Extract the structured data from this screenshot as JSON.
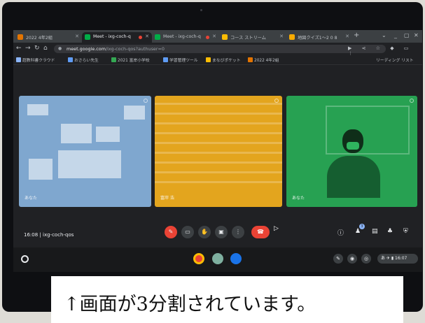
{
  "browser": {
    "tabs": [
      {
        "label": "2022 4年2組",
        "icon_color": "#e37400",
        "active": false
      },
      {
        "label": "Meet - ixg-coch-q",
        "icon_color": "#00ac47",
        "active": true
      },
      {
        "label": "Meet - ixg-coch-q",
        "icon_color": "#00ac47",
        "active": false
      },
      {
        "label": "コース ストリーム",
        "icon_color": "#fbbc04",
        "active": false
      },
      {
        "label": "地図クイズ1～2 0 8",
        "icon_color": "#f9ab00",
        "active": false
      }
    ],
    "new_tab_label": "+",
    "url_host": "meet.google.com",
    "url_path": "/ixg-coch-qos?authuser=0",
    "bookmarks": [
      {
        "label": "超教科書クラウド",
        "icon_color": "#8ab4f8"
      },
      {
        "label": "おさらい先生",
        "icon_color": "#5f9cf5"
      },
      {
        "label": "2021 富岸小学校",
        "icon_color": "#34a853"
      },
      {
        "label": "学習管理ツール",
        "icon_color": "#5f9cf5"
      },
      {
        "label": "まなびポケット",
        "icon_color": "#fbbc04"
      },
      {
        "label": "2022 4年2組",
        "icon_color": "#e37400"
      }
    ],
    "reading_list_label": "リーディング リスト"
  },
  "meet": {
    "tiles": [
      {
        "name": "あなた",
        "color": "#7fa7cf"
      },
      {
        "name": "富岸 浩",
        "color": "#e3a51e"
      },
      {
        "name": "あなた",
        "color": "#27a152"
      }
    ],
    "time": "16:08",
    "separator": "|",
    "meeting_code": "ixg-coch-qos",
    "participant_count": "3"
  },
  "shelf": {
    "status_time": "16:07",
    "status_label": "あ ✈ ▮ 16:07"
  },
  "caption": {
    "text": "↑画面が3分割されています。"
  }
}
